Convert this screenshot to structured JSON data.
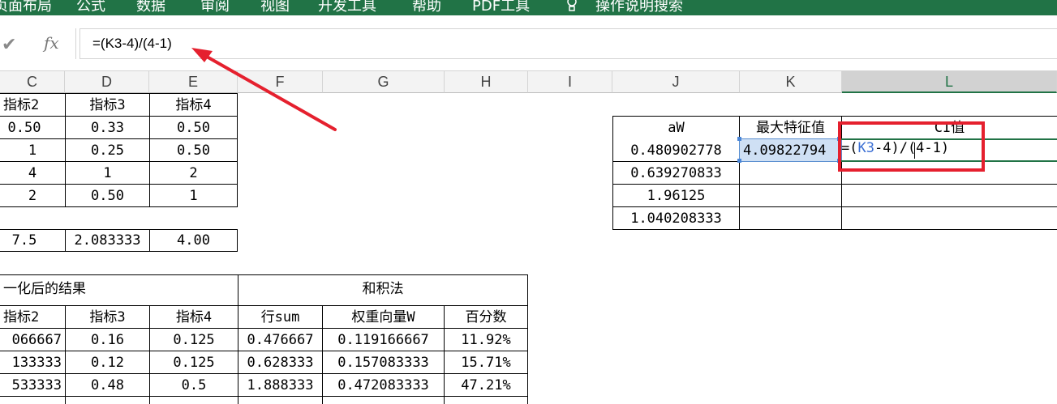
{
  "ribbon": {
    "tabs": [
      "页面布局",
      "公式",
      "数据",
      "审阅",
      "视图",
      "开发工具",
      "帮助",
      "PDF工具",
      "操作说明搜索"
    ]
  },
  "formula_bar": {
    "cancel_icon": "check-icon",
    "fx_label": "fx",
    "formula": "=(K3-4)/(4-1)"
  },
  "columns": [
    "C",
    "D",
    "E",
    "F",
    "G",
    "H",
    "I",
    "J",
    "K",
    "L"
  ],
  "upper_table": {
    "header": [
      "指标2",
      "指标3",
      "指标4"
    ],
    "rows": [
      [
        "0.50",
        "0.33",
        "0.50"
      ],
      [
        "1",
        "0.25",
        "0.50"
      ],
      [
        "4",
        "1",
        "2"
      ],
      [
        "2",
        "0.50",
        "1"
      ]
    ],
    "sum_row": [
      "7.5",
      "2.083333",
      "4.00"
    ]
  },
  "right_table": {
    "headers": [
      "aW",
      "最大特征值",
      "CI值"
    ],
    "aw_values": [
      "0.480902778",
      "0.639270833",
      "1.96125",
      "1.040208333"
    ],
    "max_eigenvalue": "4.09822794",
    "editing_formula_parts": [
      "=(",
      "K3",
      "-4)",
      "/",
      "(4-1)"
    ]
  },
  "lower_table": {
    "group1_title": "一化后的结果",
    "group2_title": "和积法",
    "header": [
      "指标2",
      "指标3",
      "指标4",
      "行sum",
      "权重向量W",
      "百分数"
    ],
    "rows": [
      [
        "066667",
        "0.16",
        "0.125",
        "0.476667",
        "0.119166667",
        "11.92%"
      ],
      [
        "133333",
        "0.12",
        "0.125",
        "0.628333",
        "0.157083333",
        "15.71%"
      ],
      [
        "533333",
        "0.48",
        "0.5",
        "1.888333",
        "0.472083333",
        "47.21%"
      ]
    ]
  },
  "colors": {
    "ribbon": "#217346",
    "highlight_box": "#e5202e",
    "arrow": "#e5202e",
    "selected_cell": "#cfe0f4",
    "cell_reference": "#3b6fd4"
  }
}
